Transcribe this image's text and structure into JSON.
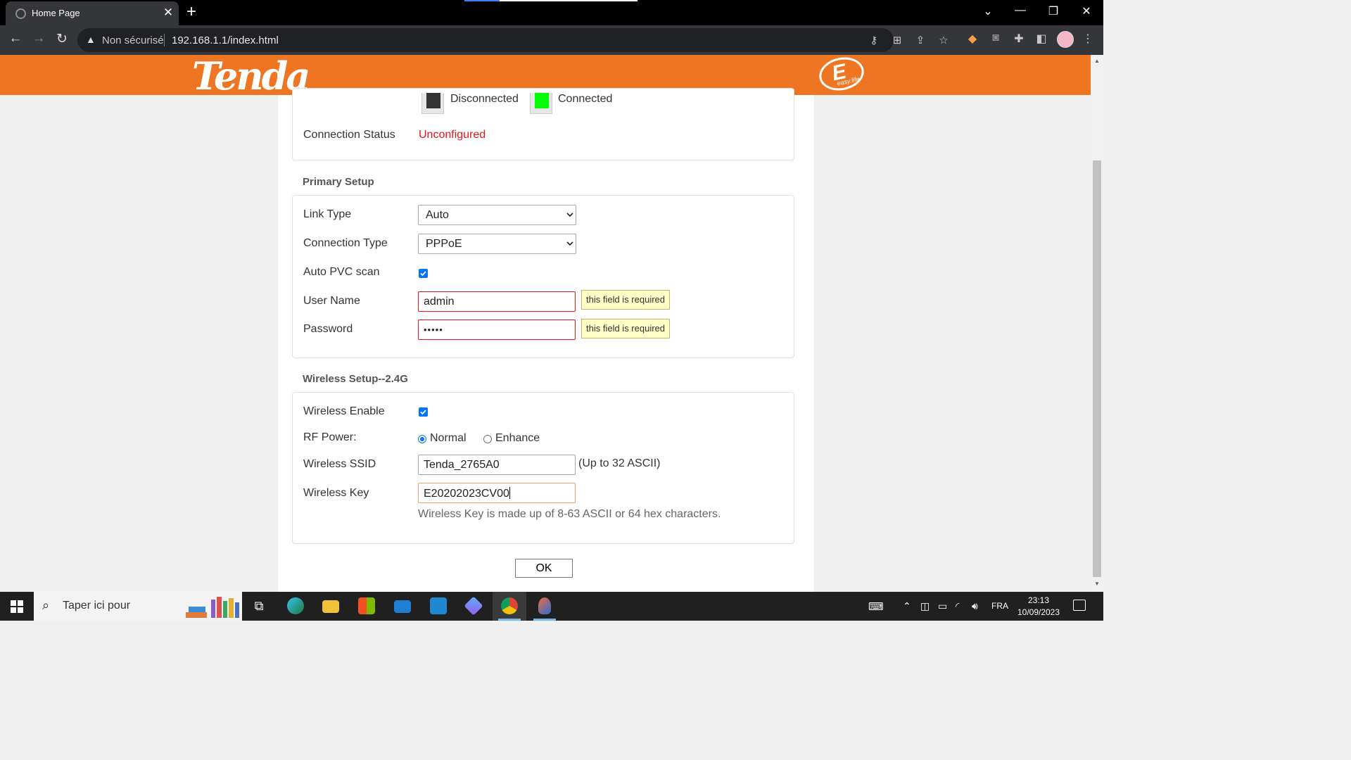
{
  "browser": {
    "tab_title": "Home Page",
    "tab_close": "✕",
    "new_tab": "+",
    "security_label": "Non sécurisé",
    "url": "192.168.1.1/index.html",
    "window": {
      "minimize": "—",
      "restore": "❐",
      "close": "✕",
      "tab_search": "⌄"
    },
    "nav": {
      "back": "←",
      "forward": "→",
      "reload": "↻"
    },
    "toolbar_icons": [
      "key-icon",
      "translate-icon",
      "share-icon",
      "bookmark-star-icon",
      "metamask-fox-icon",
      "robot-extension-icon",
      "extensions-puzzle-icon",
      "side-panel-icon",
      "profile-avatar-icon",
      "chrome-menu-icon"
    ]
  },
  "header": {
    "brand": "Tenda",
    "easy_logo_letter": "E",
    "easy_logo_text": "easy.life"
  },
  "status_panel": {
    "legend_disconnected": "Disconnected",
    "legend_connected": "Connected",
    "connection_status_label": "Connection Status",
    "connection_status_value": "Unconfigured"
  },
  "primary_setup": {
    "title": "Primary Setup",
    "link_type_label": "Link Type",
    "link_type_value": "Auto",
    "connection_type_label": "Connection Type",
    "connection_type_value": "PPPoE",
    "auto_pvc_label": "Auto PVC scan",
    "auto_pvc_checked": true,
    "username_label": "User Name",
    "username_value": "admin",
    "password_label": "Password",
    "password_value": "•••••",
    "required_tip": "this field is required"
  },
  "wireless_setup": {
    "title": "Wireless Setup--2.4G",
    "enable_label": "Wireless Enable",
    "enable_checked": true,
    "rf_power_label": "RF Power:",
    "rf_normal": "Normal",
    "rf_enhance": "Enhance",
    "rf_selected": "Normal",
    "ssid_label": "Wireless SSID",
    "ssid_value": "Tenda_2765A0",
    "ssid_hint": "(Up to 32 ASCII)",
    "key_label": "Wireless Key",
    "key_value": "E20202023CV00",
    "key_note": "Wireless Key is made up of 8-63 ASCII or 64 hex characters."
  },
  "ok_button": "OK",
  "taskbar": {
    "search_placeholder": "Taper ici pour",
    "apps": [
      "task-view",
      "edge",
      "file-explorer",
      "microsoft-store",
      "mail",
      "vscode",
      "copilot",
      "chrome",
      "paint"
    ],
    "active_apps": [
      "chrome",
      "paint"
    ],
    "language": "FRA",
    "time": "23:13",
    "date": "10/09/2023"
  },
  "colors": {
    "brand_orange": "#ee7623",
    "error_red": "#e8121a",
    "connected_green": "#00ff00",
    "disconnected_dark": "#333333",
    "checkbox_blue": "#0075ff",
    "tooltip_bg": "#ffffc8"
  }
}
